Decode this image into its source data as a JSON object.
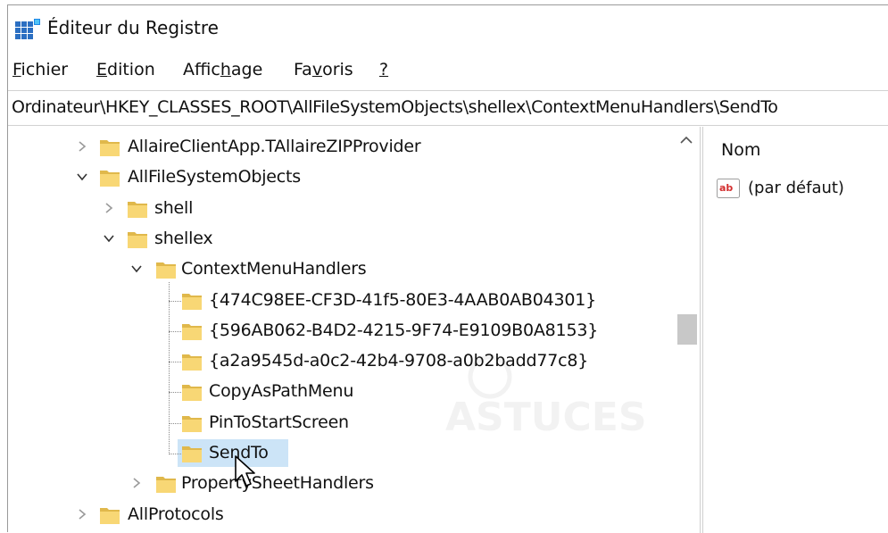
{
  "window": {
    "title": "Éditeur du Registre",
    "icon": "regedit-icon"
  },
  "menu": [
    {
      "pre": "",
      "u": "F",
      "post": "ichier"
    },
    {
      "pre": "",
      "u": "E",
      "post": "dition"
    },
    {
      "pre": "Affic",
      "u": "h",
      "post": "age"
    },
    {
      "pre": "Fa",
      "u": "v",
      "post": "oris"
    },
    {
      "pre": "",
      "u": "?",
      "post": ""
    }
  ],
  "address": "Ordinateur\\HKEY_CLASSES_ROOT\\AllFileSystemObjects\\shellex\\ContextMenuHandlers\\SendTo",
  "tree": [
    {
      "label": "AllaireClientApp.TAllaireZIPProvider",
      "level": 0,
      "chevron": "right",
      "selected": false
    },
    {
      "label": "AllFileSystemObjects",
      "level": 0,
      "chevron": "down",
      "selected": false
    },
    {
      "label": "shell",
      "level": 1,
      "chevron": "right",
      "selected": false
    },
    {
      "label": "shellex",
      "level": 1,
      "chevron": "down",
      "selected": false
    },
    {
      "label": "ContextMenuHandlers",
      "level": 2,
      "chevron": "down",
      "selected": false
    },
    {
      "label": "{474C98EE-CF3D-41f5-80E3-4AAB0AB04301}",
      "level": 3,
      "chevron": "none",
      "selected": false
    },
    {
      "label": "{596AB062-B4D2-4215-9F74-E9109B0A8153}",
      "level": 3,
      "chevron": "none",
      "selected": false
    },
    {
      "label": "{a2a9545d-a0c2-42b4-9708-a0b2badd77c8}",
      "level": 3,
      "chevron": "none",
      "selected": false
    },
    {
      "label": "CopyAsPathMenu",
      "level": 3,
      "chevron": "none",
      "selected": false
    },
    {
      "label": "PinToStartScreen",
      "level": 3,
      "chevron": "none",
      "selected": false
    },
    {
      "label": "SendTo",
      "level": 3,
      "chevron": "none",
      "selected": true
    },
    {
      "label": "PropertySheetHandlers",
      "level": 2,
      "chevron": "right",
      "selected": false
    },
    {
      "label": "AllProtocols",
      "level": 0,
      "chevron": "right",
      "selected": false
    }
  ],
  "values": {
    "column_header": "Nom",
    "rows": [
      {
        "name": "(par défaut)",
        "icon": "string-value-icon"
      }
    ]
  },
  "colors": {
    "selection": "#cce4f7",
    "folder": "#f8d775",
    "folder_dark": "#e0b84b"
  }
}
